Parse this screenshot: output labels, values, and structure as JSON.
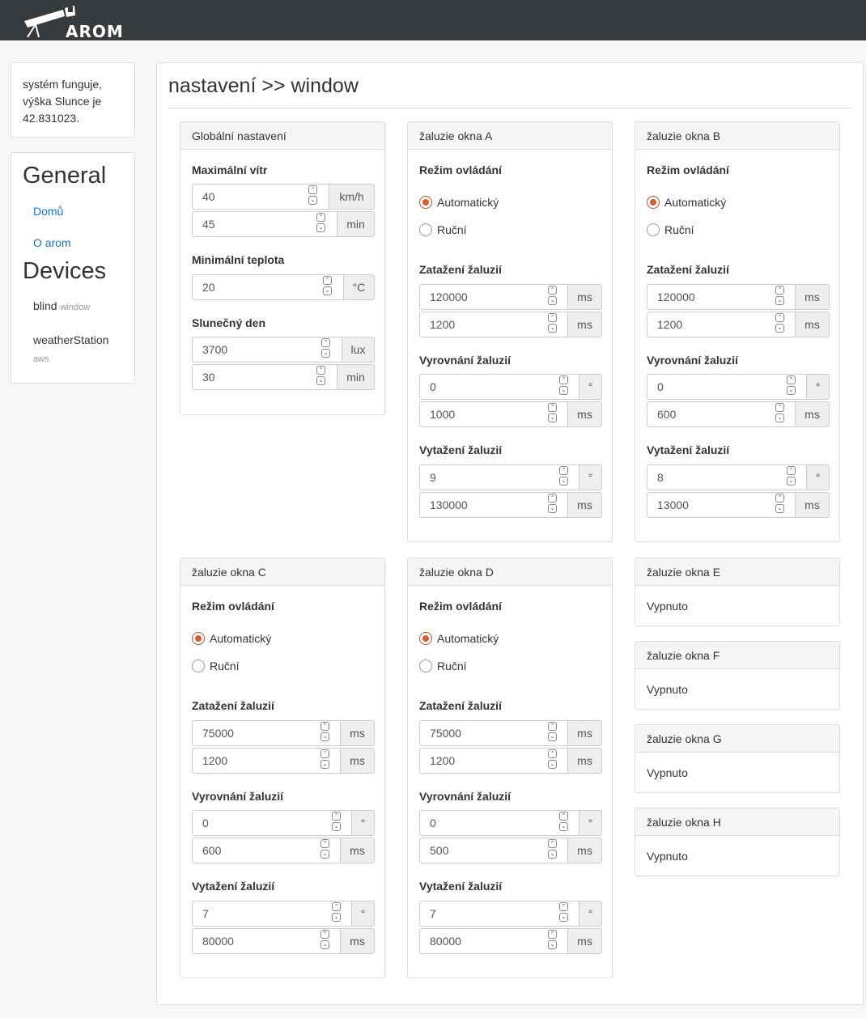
{
  "brand": {
    "logo_text": "AROM"
  },
  "status": {
    "text": "systém funguje, výška Slunce je 42.831023."
  },
  "nav": {
    "general_heading": "General",
    "devices_heading": "Devices",
    "links": [
      {
        "label": "Domů"
      },
      {
        "label": "O arom"
      }
    ],
    "devices": [
      {
        "name": "blind",
        "type": "window"
      },
      {
        "name": "weatherStation",
        "type": "aws"
      }
    ]
  },
  "page": {
    "title": "nastavení >> window"
  },
  "global": {
    "title": "Globální nastavení",
    "max_wind_label": "Maximální vítr",
    "max_wind_value": "40",
    "max_wind_unit": "km/h",
    "max_wind_time": "45",
    "max_wind_time_unit": "min",
    "min_temp_label": "Minimální teplota",
    "min_temp_value": "20",
    "min_temp_unit": "°C",
    "sunny_label": "Slunečný den",
    "sunny_value": "3700",
    "sunny_unit": "lux",
    "sunny_time": "30",
    "sunny_time_unit": "min"
  },
  "labels": {
    "mode": "Režim ovládání",
    "auto": "Automatický",
    "manual": "Ruční",
    "pull": "Zatažení žaluzií",
    "level": "Vyrovnání žaluzií",
    "raise": "Vytažení žaluzií",
    "ms": "ms",
    "deg": "°"
  },
  "panels": {
    "A": {
      "title": "žaluzie okna A",
      "pull_1": "120000",
      "pull_2": "1200",
      "level_1": "0",
      "level_2": "1000",
      "raise_1": "9",
      "raise_2": "130000"
    },
    "B": {
      "title": "žaluzie okna B",
      "pull_1": "120000",
      "pull_2": "1200",
      "level_1": "0",
      "level_2": "600",
      "raise_1": "8",
      "raise_2": "13000"
    },
    "C": {
      "title": "žaluzie okna C",
      "pull_1": "75000",
      "pull_2": "1200",
      "level_1": "0",
      "level_2": "600",
      "raise_1": "7",
      "raise_2": "80000"
    },
    "D": {
      "title": "žaluzie okna D",
      "pull_1": "75000",
      "pull_2": "1200",
      "level_1": "0",
      "level_2": "500",
      "raise_1": "7",
      "raise_2": "80000"
    },
    "E": {
      "title": "žaluzie okna E",
      "status": "Vypnuto"
    },
    "F": {
      "title": "žaluzie okna F",
      "status": "Vypnuto"
    },
    "G": {
      "title": "žaluzie okna G",
      "status": "Vypnuto"
    },
    "H": {
      "title": "žaluzie okna H",
      "status": "Vypnuto"
    }
  }
}
